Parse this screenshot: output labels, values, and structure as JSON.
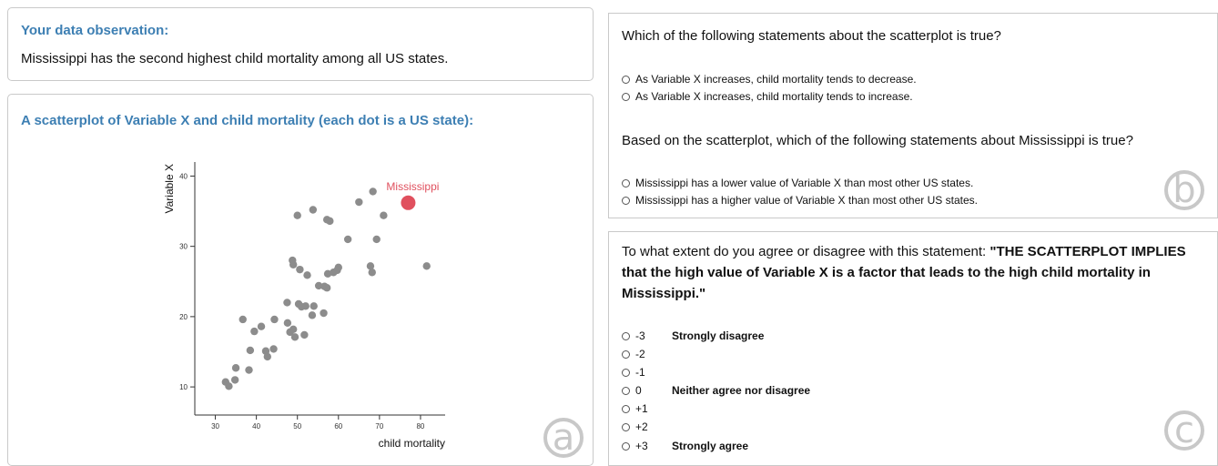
{
  "observation": {
    "heading": "Your data observation:",
    "text": "Mississippi has the second highest child mortality among all US states."
  },
  "scatter_panel": {
    "heading": "A scatterplot of Variable X and child mortality (each dot is a US state):",
    "corner_label": "a"
  },
  "question_b": {
    "q1": "Which of the following statements about the scatterplot is true?",
    "q1_options": [
      "As Variable X increases, child mortality tends to decrease.",
      "As Variable X increases, child mortality tends to increase."
    ],
    "q2": "Based on the scatterplot, which of the following statements about Mississippi is true?",
    "q2_options": [
      "Mississippi has a lower value of Variable X than most other US states.",
      "Mississippi has a higher value of Variable X than most other US states."
    ],
    "corner_label": "b"
  },
  "question_c": {
    "prompt_prefix": "To what extent do you agree or disagree with this statement: ",
    "prompt_bold": "\"THE SCATTERPLOT IMPLIES that the high value of Variable X is a factor that leads to the high child mortality in Mississippi.\"",
    "scale": [
      {
        "value": "-3",
        "label": "Strongly disagree"
      },
      {
        "value": "-2",
        "label": ""
      },
      {
        "value": "-1",
        "label": ""
      },
      {
        "value": "0",
        "label": "Neither agree nor disagree"
      },
      {
        "value": "+1",
        "label": ""
      },
      {
        "value": "+2",
        "label": ""
      },
      {
        "value": "+3",
        "label": "Strongly agree"
      }
    ],
    "corner_label": "c"
  },
  "chart_data": {
    "type": "scatter",
    "xlabel": "child mortality",
    "ylabel": "Variable X",
    "xlim": [
      25,
      86
    ],
    "ylim": [
      6,
      42
    ],
    "x_ticks": [
      30,
      40,
      50,
      60,
      70,
      80
    ],
    "y_ticks": [
      10,
      20,
      30,
      40
    ],
    "point_color": "#8c8c8c",
    "highlight_color": "#e0505e",
    "highlight": {
      "name": "Mississippi",
      "x": 77,
      "y": 36.2
    },
    "points": [
      {
        "x": 32.5,
        "y": 10.7
      },
      {
        "x": 33.3,
        "y": 10.1
      },
      {
        "x": 34.8,
        "y": 11.0
      },
      {
        "x": 35.0,
        "y": 12.7
      },
      {
        "x": 38.2,
        "y": 12.4
      },
      {
        "x": 36.7,
        "y": 19.6
      },
      {
        "x": 38.5,
        "y": 15.2
      },
      {
        "x": 39.5,
        "y": 17.9
      },
      {
        "x": 41.2,
        "y": 18.6
      },
      {
        "x": 42.3,
        "y": 15.1
      },
      {
        "x": 42.7,
        "y": 14.3
      },
      {
        "x": 44.2,
        "y": 15.4
      },
      {
        "x": 44.4,
        "y": 19.6
      },
      {
        "x": 47.5,
        "y": 22.0
      },
      {
        "x": 47.6,
        "y": 19.1
      },
      {
        "x": 48.2,
        "y": 17.8
      },
      {
        "x": 49.0,
        "y": 18.2
      },
      {
        "x": 49.4,
        "y": 17.1
      },
      {
        "x": 50.3,
        "y": 21.8
      },
      {
        "x": 51.0,
        "y": 21.4
      },
      {
        "x": 51.7,
        "y": 17.4
      },
      {
        "x": 52.0,
        "y": 21.5
      },
      {
        "x": 53.6,
        "y": 20.2
      },
      {
        "x": 54.0,
        "y": 21.5
      },
      {
        "x": 56.4,
        "y": 20.5
      },
      {
        "x": 48.8,
        "y": 28.0
      },
      {
        "x": 49.0,
        "y": 27.4
      },
      {
        "x": 50.6,
        "y": 26.7
      },
      {
        "x": 52.4,
        "y": 25.9
      },
      {
        "x": 55.2,
        "y": 24.4
      },
      {
        "x": 56.6,
        "y": 24.3
      },
      {
        "x": 57.2,
        "y": 24.1
      },
      {
        "x": 57.4,
        "y": 26.1
      },
      {
        "x": 58.8,
        "y": 26.3
      },
      {
        "x": 59.7,
        "y": 26.6
      },
      {
        "x": 60.0,
        "y": 27.0
      },
      {
        "x": 50.0,
        "y": 34.4
      },
      {
        "x": 53.8,
        "y": 35.2
      },
      {
        "x": 57.2,
        "y": 33.8
      },
      {
        "x": 57.9,
        "y": 33.6
      },
      {
        "x": 62.3,
        "y": 31.0
      },
      {
        "x": 65.0,
        "y": 36.3
      },
      {
        "x": 67.8,
        "y": 27.2
      },
      {
        "x": 68.2,
        "y": 26.3
      },
      {
        "x": 68.4,
        "y": 37.8
      },
      {
        "x": 69.3,
        "y": 31.0
      },
      {
        "x": 71.0,
        "y": 34.4
      },
      {
        "x": 81.5,
        "y": 27.2
      }
    ]
  }
}
